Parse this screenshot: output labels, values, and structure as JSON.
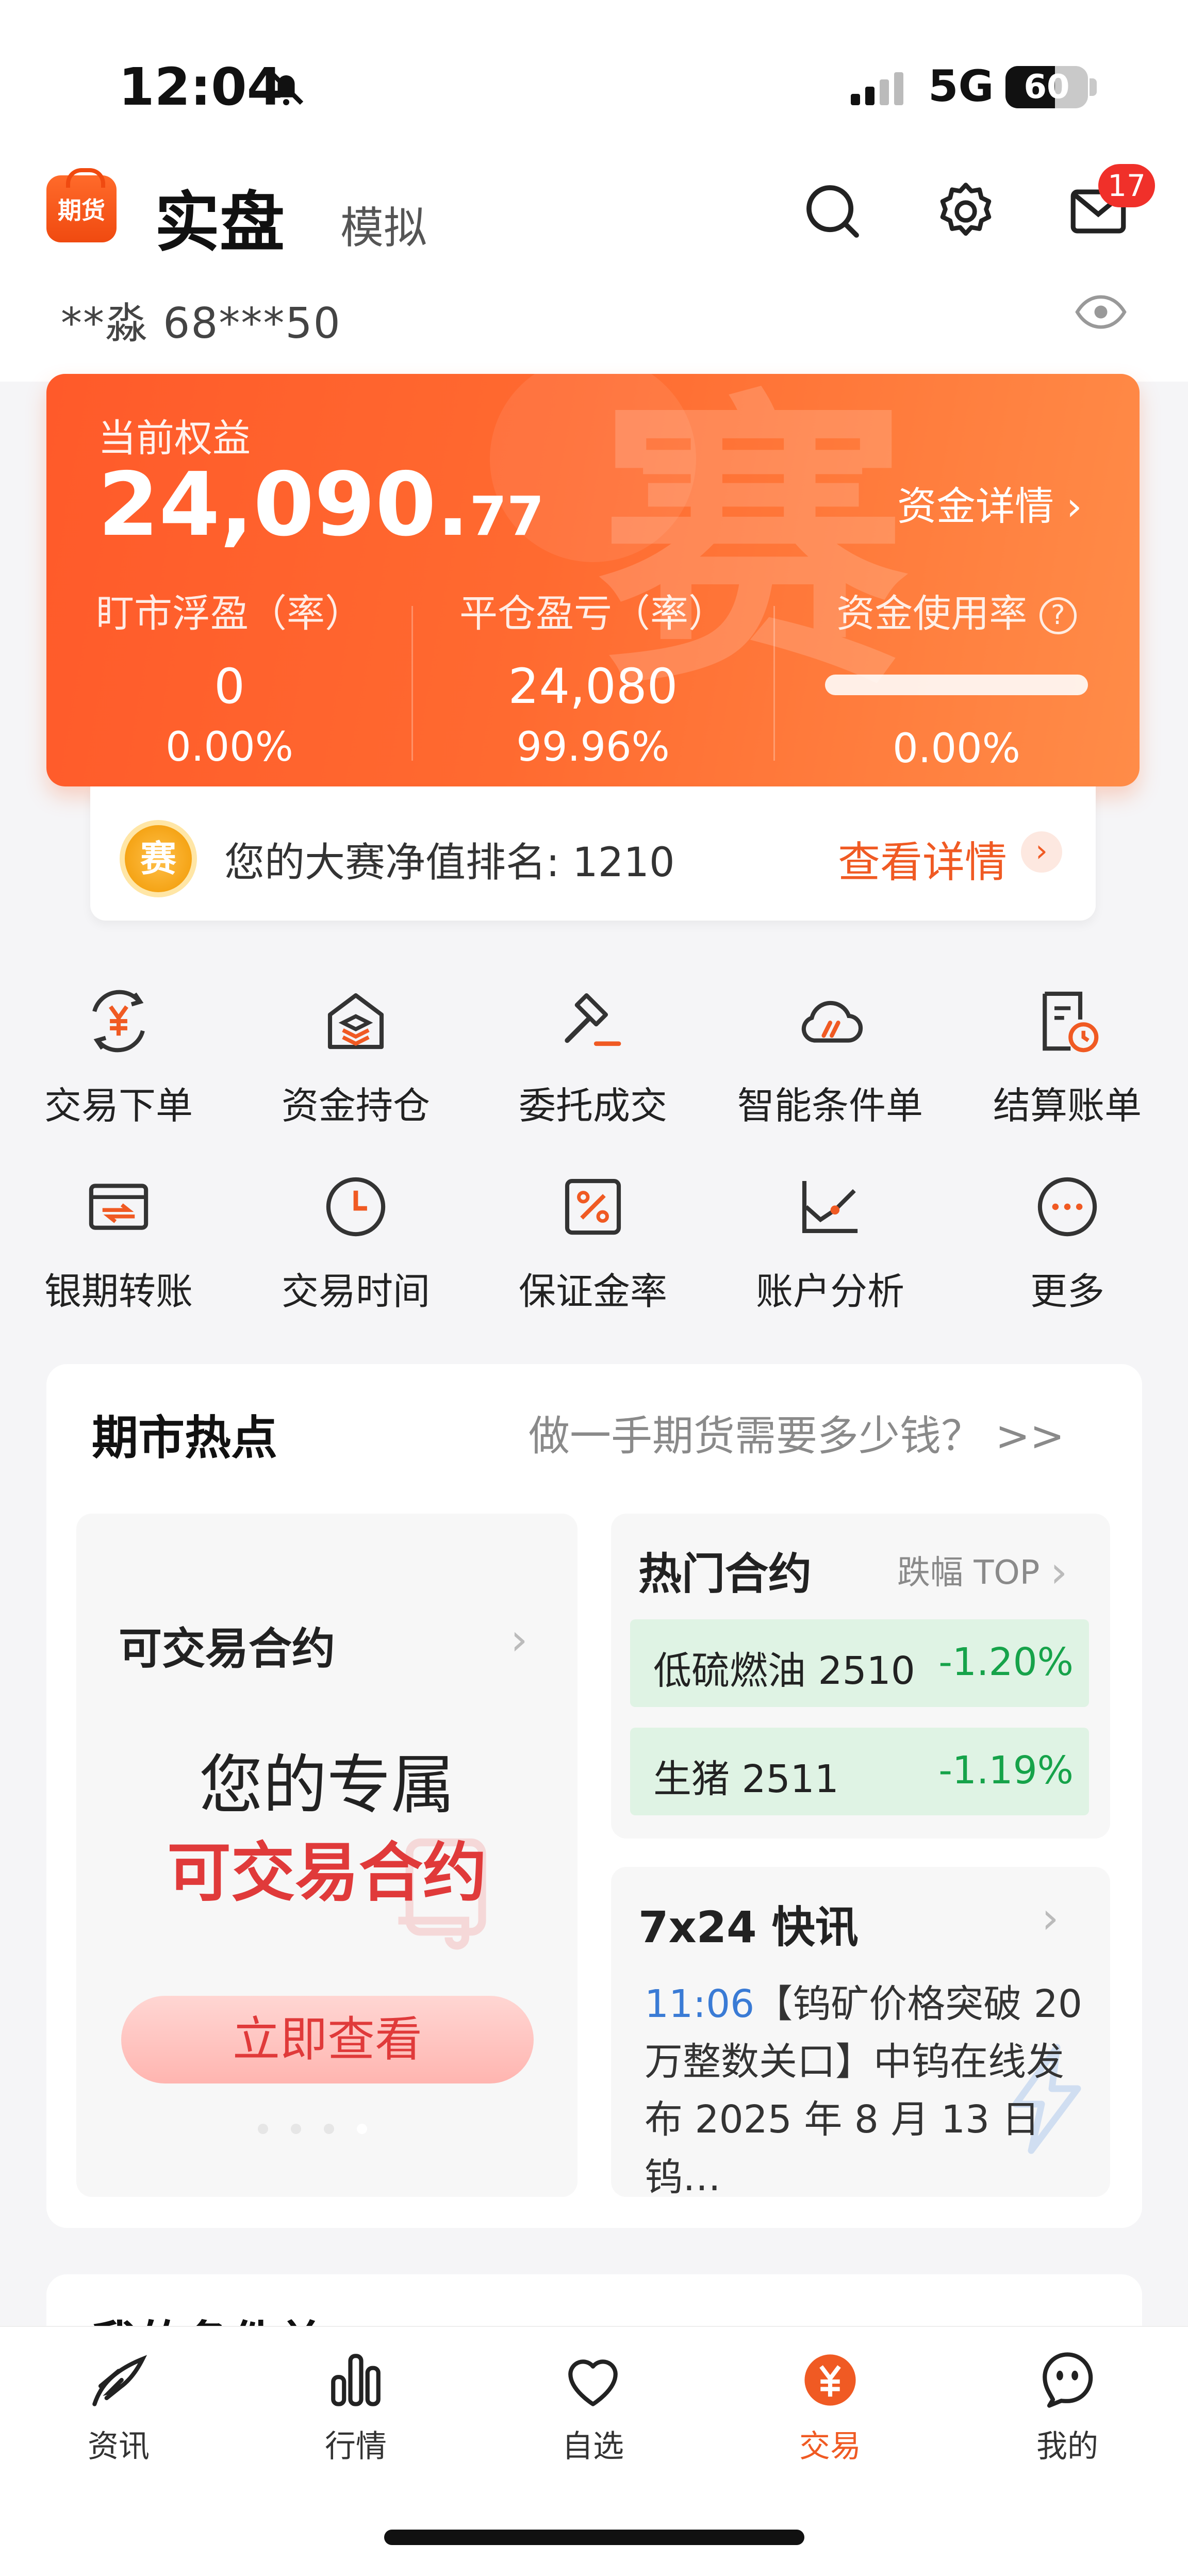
{
  "status_bar": {
    "time": "12:04",
    "network": "5G",
    "battery": "60",
    "battery_level": 0.6
  },
  "header": {
    "logo_text": "期货",
    "tab_real": "实盘",
    "tab_sim": "模拟",
    "mail_badge": "17",
    "account": "**淼  68***50"
  },
  "equity_card": {
    "label": "当前权益",
    "value_main": "24,090.",
    "value_decimal": "77",
    "detail_link": "资金详情 ›",
    "deco_char": "赛",
    "stats": [
      {
        "title": "盯市浮盈（率）",
        "value": "0",
        "pct": "0.00%"
      },
      {
        "title": "平仓盈亏（率）",
        "value": "24,080",
        "pct": "99.96%"
      },
      {
        "title": "资金使用率",
        "value": "",
        "pct": "0.00%",
        "help": "?"
      }
    ],
    "usage_fraction": 0.0
  },
  "ranking": {
    "coin": "赛",
    "text": "您的大赛净值排名: 1210",
    "link": "查看详情",
    "arrow": "›"
  },
  "menu": [
    {
      "label": "交易下单",
      "icon": "yuan-exchange-icon"
    },
    {
      "label": "资金持仓",
      "icon": "house-stack-icon"
    },
    {
      "label": "委托成交",
      "icon": "gavel-icon"
    },
    {
      "label": "智能条件单",
      "icon": "cloud-icon"
    },
    {
      "label": "结算账单",
      "icon": "bill-clock-icon"
    },
    {
      "label": "银期转账",
      "icon": "card-transfer-icon"
    },
    {
      "label": "交易时间",
      "icon": "clock-icon"
    },
    {
      "label": "保证金率",
      "icon": "percent-icon"
    },
    {
      "label": "账户分析",
      "icon": "line-chart-icon"
    },
    {
      "label": "更多",
      "icon": "more-icon"
    }
  ],
  "market_hot": {
    "title": "期市热点",
    "link": "做一手期货需要多少钱？ >>",
    "contract_card": {
      "title": "可交易合约",
      "line1": "您的专属",
      "line2": "可交易合约",
      "button": "立即查看"
    },
    "hot_contracts": {
      "title": "热门合约",
      "subtitle": "跌幅 TOP",
      "rows": [
        {
          "name": "低硫燃油 2510",
          "change": "-1.20%"
        },
        {
          "name": "生猪 2511",
          "change": "-1.19%"
        }
      ]
    },
    "news": {
      "title": "7x24 快讯",
      "time": "11:06",
      "text": "【钨矿价格突破 20 万整数关口】中钨在线发布 2025 年 8 月 13 日钨…"
    }
  },
  "next_section": {
    "title": "我的条件单"
  },
  "bottom_nav": [
    {
      "label": "资讯",
      "icon": "feather-icon",
      "active": false
    },
    {
      "label": "行情",
      "icon": "bar-chart-icon",
      "active": false
    },
    {
      "label": "自选",
      "icon": "heart-icon",
      "active": false
    },
    {
      "label": "交易",
      "icon": "yuan-coin-icon",
      "active": true
    },
    {
      "label": "我的",
      "icon": "face-icon",
      "active": false
    }
  ],
  "colors": {
    "accent": "#f05a23",
    "card_start": "#ff5a2a",
    "card_end": "#ff8c48",
    "down_green": "#16a34a",
    "red": "#e03a3a"
  }
}
